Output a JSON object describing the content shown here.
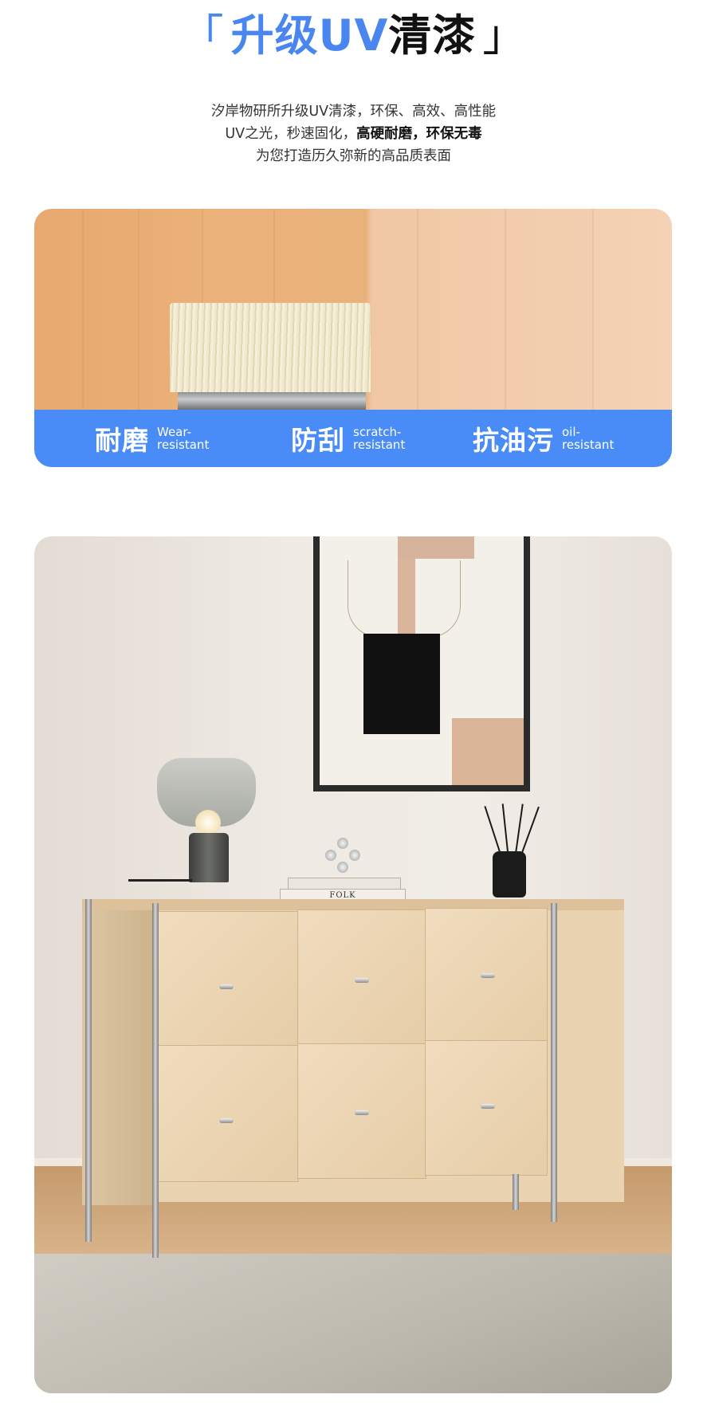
{
  "heading": {
    "open_bracket": "「",
    "highlight": "升级UV",
    "dark": "清漆",
    "close_bracket": "」"
  },
  "intro": {
    "line1": "汐岸物研所升级UV清漆，环保、高效、高性能",
    "line2_normal": "UV之光，秒速固化，",
    "line2_bold": "高硬耐磨，环保无毒",
    "line3": "为您打造历久弥新的高品质表面"
  },
  "features": [
    {
      "cn": "耐磨",
      "en": "Wear-\nresistant"
    },
    {
      "cn": "防刮",
      "en": "scratch-\nresistant"
    },
    {
      "cn": "抗油污",
      "en": "oil-\nresistant"
    }
  ],
  "book_spine": "FOLK",
  "colors": {
    "accent_blue": "#4a8cf7",
    "title_blue": "#4a86f0"
  }
}
